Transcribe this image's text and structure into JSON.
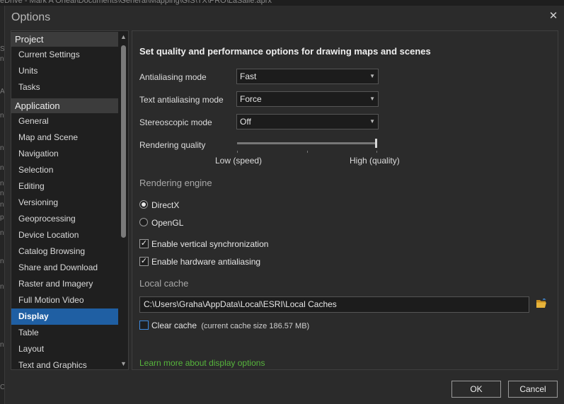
{
  "background": {
    "window_title": "eDrive - Mark A Oneal\\Documents\\General\\Mapping\\GIS\\TX\\PRO\\LaSalle.aprx",
    "edge_fragments": [
      "St",
      "ne",
      "A",
      "ne",
      "ne",
      "ne",
      "ne",
      "ne",
      "ne",
      "p",
      "n",
      "ne",
      "ne",
      "ne",
      "C"
    ]
  },
  "dialog": {
    "title": "Options",
    "close_glyph": "✕"
  },
  "sidebar": {
    "groups": [
      {
        "header": "Project",
        "items": [
          "Current Settings",
          "Units",
          "Tasks"
        ]
      },
      {
        "header": "Application",
        "items": [
          "General",
          "Map and Scene",
          "Navigation",
          "Selection",
          "Editing",
          "Versioning",
          "Geoprocessing",
          "Device Location",
          "Catalog Browsing",
          "Share and Download",
          "Raster and Imagery",
          "Full Motion Video",
          "Display",
          "Table",
          "Layout",
          "Text and Graphics"
        ]
      }
    ],
    "selected_item": "Display"
  },
  "main": {
    "heading": "Set quality and performance options for drawing maps and scenes",
    "antialiasing": {
      "label": "Antialiasing mode",
      "value": "Fast"
    },
    "text_antialiasing": {
      "label": "Text antialiasing mode",
      "value": "Force"
    },
    "stereoscopic": {
      "label": "Stereoscopic mode",
      "value": "Off"
    },
    "rendering_quality": {
      "label": "Rendering quality",
      "low_label": "Low (speed)",
      "high_label": "High (quality)",
      "level": 1.0
    },
    "rendering_engine": {
      "label": "Rendering engine",
      "options": [
        "DirectX",
        "OpenGL"
      ],
      "selected": "DirectX"
    },
    "vsync": {
      "label": "Enable vertical synchronization",
      "checked": true
    },
    "hw_antialiasing": {
      "label": "Enable hardware antialiasing",
      "checked": true
    },
    "local_cache": {
      "label": "Local cache",
      "path": "C:\\Users\\Graha\\AppData\\Local\\ESRI\\Local Caches",
      "clear_label": "Clear cache",
      "size_note": "(current cache size 186.57 MB)",
      "clear_checked": false
    },
    "learn_more": "Learn more about display options"
  },
  "footer": {
    "ok": "OK",
    "cancel": "Cancel"
  },
  "colors": {
    "accent": "#1f5fa3",
    "link": "#56b53c",
    "folder": "#e7b33a"
  }
}
